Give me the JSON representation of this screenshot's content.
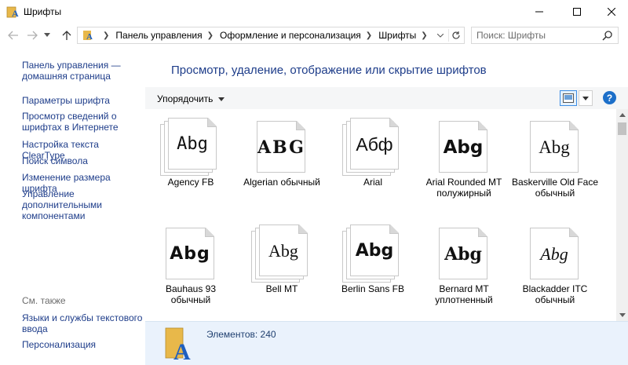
{
  "window": {
    "title": "Шрифты",
    "minimize": "minimize",
    "maximize": "maximize",
    "close": "close"
  },
  "address": {
    "crumbs": [
      "Панель управления",
      "Оформление и персонализация",
      "Шрифты"
    ],
    "search_placeholder": "Поиск: Шрифты"
  },
  "sidebar": {
    "home": "Панель управления — домашняя страница",
    "links": [
      "Параметры шрифта",
      "Просмотр сведений о шрифтах в Интернете",
      "Настройка текста ClearType",
      "Поиск символа",
      "Изменение размера шрифта",
      "Управление дополнительными компонентами"
    ],
    "see_also_title": "См. также",
    "see_also": [
      "Языки и службы текстового ввода",
      "Персонализация"
    ]
  },
  "main": {
    "page_title": "Просмотр, удаление, отображение или скрытие шрифтов",
    "organize_label": "Упорядочить",
    "help_label": "?"
  },
  "fonts": [
    {
      "name": "Agency FB",
      "sample": "Abg",
      "stacked": true
    },
    {
      "name": "Algerian обычный",
      "sample": "ABG",
      "stacked": false
    },
    {
      "name": "Arial",
      "sample": "Абф",
      "stacked": true
    },
    {
      "name": "Arial Rounded MT полужирный",
      "sample": "Abg",
      "stacked": false
    },
    {
      "name": "Baskerville Old Face обычный",
      "sample": "Abg",
      "stacked": false
    },
    {
      "name": "Bauhaus 93 обычный",
      "sample": "Abg",
      "stacked": false
    },
    {
      "name": "Bell MT",
      "sample": "Abg",
      "stacked": true
    },
    {
      "name": "Berlin Sans FB",
      "sample": "Abg",
      "stacked": true
    },
    {
      "name": "Bernard MT уплотненный",
      "sample": "Abg",
      "stacked": false
    },
    {
      "name": "Blackadder ITC обычный",
      "sample": "Abg",
      "stacked": false
    }
  ],
  "status": {
    "items_count": "Элементов: 240"
  },
  "colors": {
    "link": "#1e3d8a",
    "accent": "#1c6fc9",
    "details_bg": "#eaf2fc",
    "folder": "#e8b84a",
    "font_letter": "#1f5fbf"
  }
}
